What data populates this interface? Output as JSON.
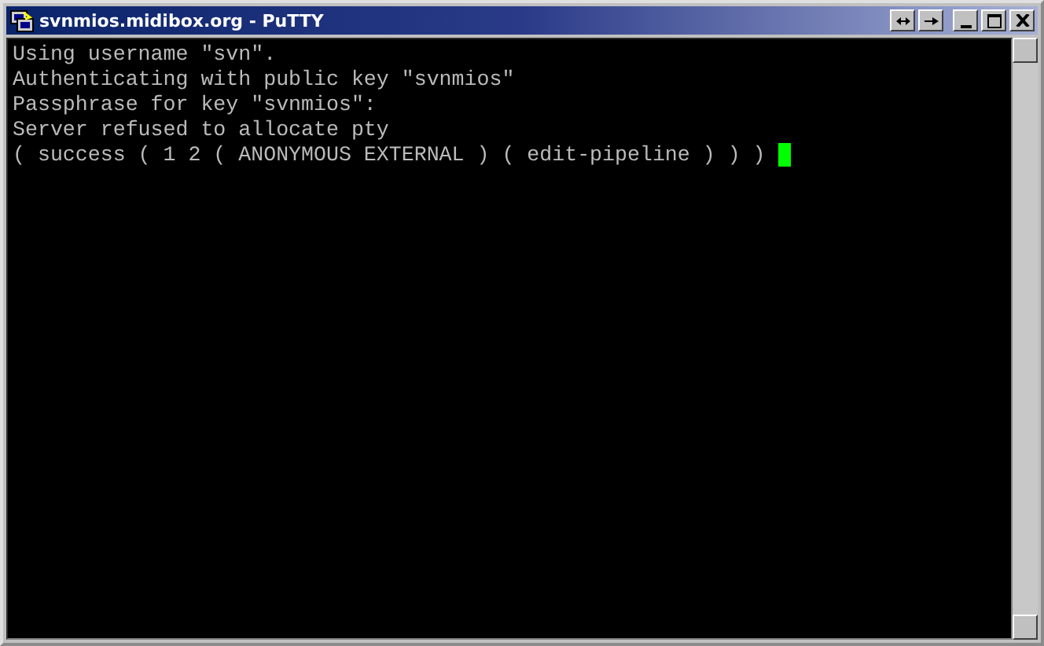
{
  "window": {
    "title": "svnmios.midibox.org - PuTTY"
  },
  "terminal": {
    "lines": [
      "Using username \"svn\".",
      "Authenticating with public key \"svnmios\"",
      "Passphrase for key \"svnmios\":",
      "Server refused to allocate pty",
      "( success ( 1 2 ( ANONYMOUS EXTERNAL ) ( edit-pipeline ) ) ) "
    ],
    "cursor_visible": true
  }
}
